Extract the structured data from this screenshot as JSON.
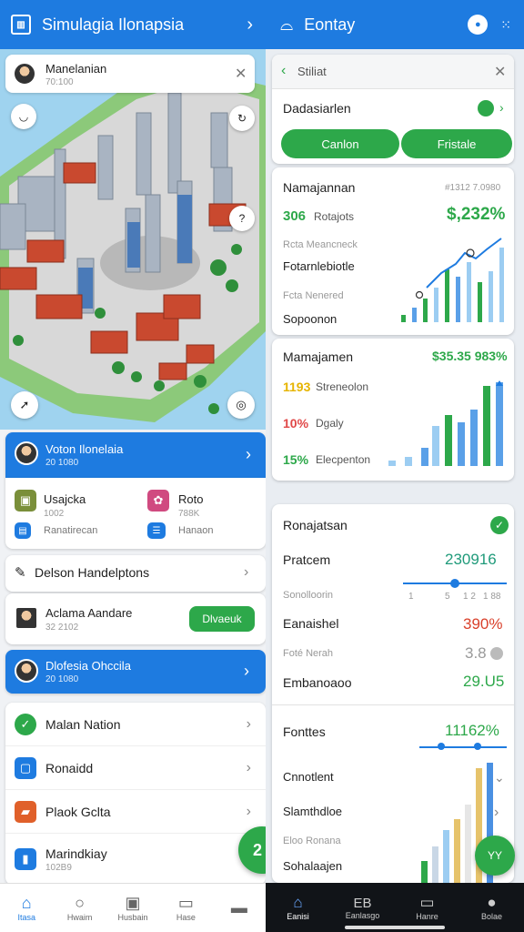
{
  "left": {
    "header": {
      "title": "Simulagia Ilonapsia"
    },
    "profile_popup": {
      "name": "Manelanian",
      "sub": "70:100"
    },
    "highlight_card": {
      "title": "Voton Ilonelaia",
      "sub": "20 1080"
    },
    "grid_items": [
      {
        "label": "Usajcka",
        "sub": "1002"
      },
      {
        "label": "Roto",
        "sub": "788K"
      },
      {
        "label": "Ranatirecan",
        "sub": ""
      },
      {
        "label": "Hanaon",
        "sub": ""
      }
    ],
    "section_header": {
      "title": "Delson Handelptons"
    },
    "contact_row": {
      "name": "Aclama Aandare",
      "sub": "32 2102",
      "button": "Dlvaeuk"
    },
    "highlight_card2": {
      "title": "Dlofesia Ohccila",
      "sub": "20 1080"
    },
    "list_items": [
      {
        "label": "Malan Nation",
        "sub": ""
      },
      {
        "label": "Ronaidd",
        "sub": ""
      },
      {
        "label": "Plaok Gclta",
        "sub": ""
      },
      {
        "label": "Marindkiay",
        "sub": "102B9"
      }
    ],
    "fab_label": "2",
    "nav": [
      "Itasa",
      "Hwaim",
      "Husbain",
      "Hase",
      ""
    ]
  },
  "right": {
    "header": {
      "title": "Eontay"
    },
    "card1": {
      "back_label": "Stiliat",
      "row_title": "Dadasiarlen",
      "btn1": "Canlon",
      "btn2": "Fristale"
    },
    "card2": {
      "title": "Namajannan",
      "meta": "#1312 7.0980",
      "stat1": {
        "value": "306",
        "label": "Rotajots",
        "amount": "$,232%"
      },
      "sub1": "Rcta Meancneck",
      "label2": "Fotarnlebiotle",
      "sub2": "Fcta Nenered",
      "label3": "Sopoonon"
    },
    "card3": {
      "title": "Mamajamen",
      "amount": "$35.35 983%",
      "rows": [
        {
          "value": "1193",
          "label": "Streneolon",
          "color": "#e6b400"
        },
        {
          "value": "10%",
          "label": "Dgaly",
          "color": "#e04848"
        },
        {
          "value": "15%",
          "label": "Elecpenton",
          "color": "#2da84a"
        }
      ]
    },
    "card4": {
      "title": "Ronajatsan",
      "items": [
        {
          "label": "Pratcem",
          "value": "230916",
          "color": "#1f9a7a"
        },
        {
          "label": "Sonolloorin",
          "value": "",
          "color": ""
        },
        {
          "label": "Eanaishel",
          "value": "390%",
          "color": "#d9402b"
        },
        {
          "label": "Foté Nerah",
          "value": "3.8",
          "color": "#999"
        },
        {
          "label": "Embanoaoo",
          "value": "29.U5",
          "color": "#2da84a"
        }
      ],
      "scale_ticks": [
        "1",
        "5",
        "1 2",
        "1 88"
      ],
      "lower_title": "Fonttes",
      "lower_value": "11162%",
      "lower_items": [
        "Cnnotlent",
        "Slamthdloe",
        "Eloo Ronana",
        "Sohalaajen"
      ],
      "fab": "YY"
    },
    "nav": [
      "Eanisi",
      "Eanlasgo",
      "Hanre",
      "Bolae"
    ]
  },
  "colors": {
    "primary": "#1e7be0",
    "green": "#2da84a",
    "dark_nav": "#111418"
  }
}
